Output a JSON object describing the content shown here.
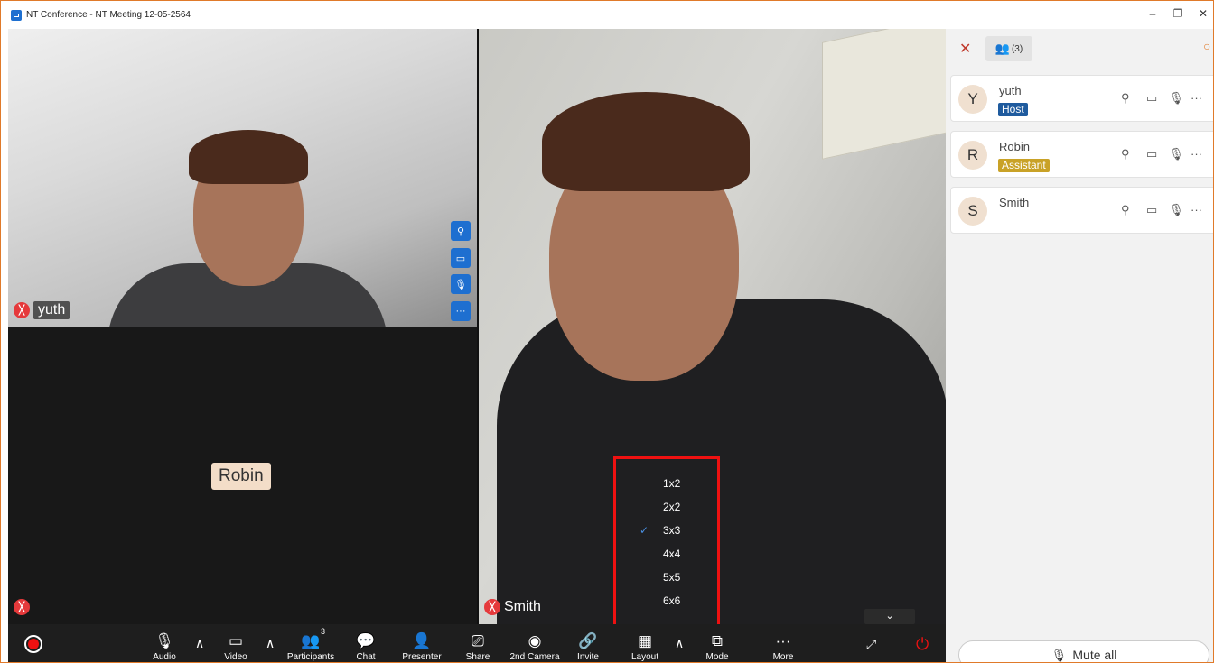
{
  "window": {
    "title": "NT Conference - NT Meeting 12-05-2564",
    "minimize": "–",
    "restore": "❐",
    "close": "✕"
  },
  "tiles": {
    "yuth": {
      "name": "yuth"
    },
    "robin": {
      "name": "Robin"
    },
    "smith": {
      "name": "Smith"
    }
  },
  "tile_actions": {
    "pin": "⚲",
    "video": "▭",
    "mic": "🎙",
    "more": "···"
  },
  "layout_menu": {
    "options": [
      "1x2",
      "2x2",
      "3x3",
      "4x4",
      "5x5",
      "6x6"
    ],
    "selected": "3x3",
    "check": "✓"
  },
  "collapse_icon": "⌄",
  "toolbar": {
    "audio": "Audio",
    "video": "Video",
    "participants": "Participants",
    "participants_count": "3",
    "chat": "Chat",
    "presenter": "Presenter",
    "share": "Share",
    "second_camera": "2nd Camera",
    "invite": "Invite",
    "layout": "Layout",
    "mode": "Mode",
    "more": "More",
    "caret": "∧"
  },
  "panel": {
    "close": "✕",
    "tab_count": "(3)",
    "participants": [
      {
        "initial": "Y",
        "name": "yuth",
        "role": "Host"
      },
      {
        "initial": "R",
        "name": "Robin",
        "role": "Assistant"
      },
      {
        "initial": "S",
        "name": "Smith",
        "role": ""
      }
    ],
    "mute_all": "Mute all"
  },
  "colors": {
    "accent": "#1e6fd0",
    "host_badge": "#1f5b9e",
    "assistant_badge": "#c9a227",
    "mic_off": "#e5393b",
    "highlight_box": "#ee1111"
  }
}
